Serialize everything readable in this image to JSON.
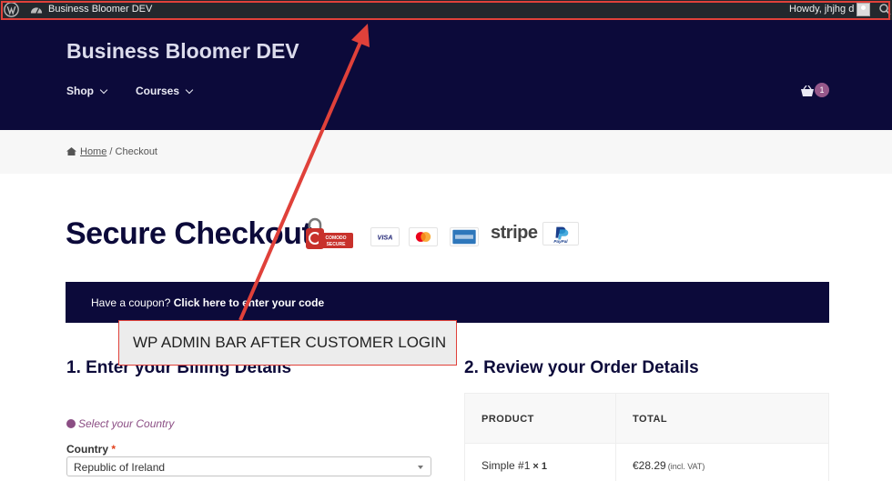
{
  "admin_bar": {
    "site_name": "Business Bloomer DEV",
    "greeting": "Howdy, jhjhg d"
  },
  "header": {
    "site_title": "Business Bloomer DEV",
    "nav": [
      {
        "label": "Shop"
      },
      {
        "label": "Courses"
      }
    ],
    "cart_count": "1"
  },
  "breadcrumb": {
    "home": "Home",
    "separator": " / ",
    "current": "Checkout"
  },
  "checkout": {
    "title": "Secure Checkout",
    "badges": {
      "comodo_line1": "COMODO",
      "comodo_line2": "SECURE",
      "visa": "VISA",
      "stripe": "stripe",
      "paypal": "PayPal"
    },
    "coupon": {
      "prompt": "Have a coupon?",
      "link": "Click here to enter your code"
    },
    "billing_heading": "1. Enter your Billing Details",
    "review_heading": "2. Review your Order Details",
    "select_country_note": "Select your Country",
    "country_label": "Country",
    "country_required_mark": "*",
    "country_value": "Republic of Ireland"
  },
  "order_table": {
    "headers": [
      "PRODUCT",
      "TOTAL"
    ],
    "rows": [
      {
        "product": "Simple #1",
        "qty": "× 1",
        "total": "€28.29",
        "tax_note": "(incl. VAT)"
      }
    ]
  },
  "annotation": {
    "callout_text": "WP ADMIN BAR AFTER CUSTOMER LOGIN",
    "color": "#e0413a"
  },
  "colors": {
    "header_bg": "#0c0a3a",
    "admin_bar_bg": "#23282d",
    "accent_purple": "#96588a"
  }
}
